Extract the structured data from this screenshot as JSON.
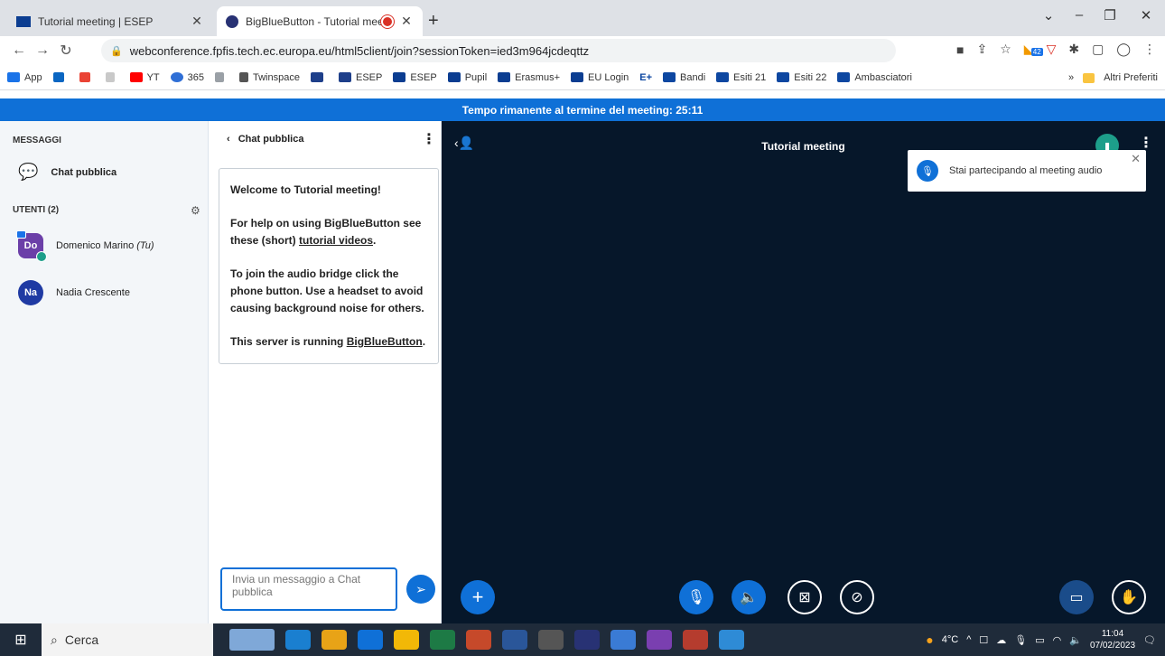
{
  "browser": {
    "tabs": [
      {
        "title": "Tutorial meeting | ESEP"
      },
      {
        "title": "BigBlueButton - Tutorial mee"
      }
    ],
    "url": "webconference.fpfis.tech.ec.europa.eu/html5client/join?sessionToken=ied3m964jcdeqttz",
    "extension_badge": "42"
  },
  "bookmarks": [
    "App",
    "YT",
    "365",
    "Twinspace",
    "ESEP",
    "ESEP",
    "Pupil",
    "Erasmus+",
    "EU Login",
    "E+",
    "Bandi",
    "Esiti 21",
    "Esiti 22",
    "Ambasciatori"
  ],
  "bookmarks_more": "»",
  "bookmarks_other": "Altri Preferiti",
  "banner": "Tempo rimanente al termine del meeting: 25:11",
  "sidebar": {
    "messages_title": "MESSAGGI",
    "public_chat": "Chat pubblica",
    "users_title": "UTENTI (2)",
    "users": [
      {
        "initials": "Do",
        "name": "Domenico Marino",
        "suffix": "(Tu)",
        "color": "#6b3fa8"
      },
      {
        "initials": "Na",
        "name": "Nadia Crescente",
        "color": "#1f3aa3"
      }
    ]
  },
  "chat": {
    "header": "Chat pubblica",
    "welcome_title": "Welcome to Tutorial meeting!",
    "help_prefix": "For help on using BigBlueButton see these (short) ",
    "help_link": "tutorial videos",
    "help_suffix": ".",
    "audio_text": "To join the audio bridge click the phone button. Use a headset to avoid causing background noise for others.",
    "server_prefix": "This server is running ",
    "server_link": "BigBlueButton",
    "server_suffix": ".",
    "input_placeholder": "Invia un messaggio a Chat pubblica"
  },
  "main": {
    "meeting_title": "Tutorial meeting",
    "toast": "Stai partecipando al meeting audio"
  },
  "taskbar": {
    "search": "Cerca",
    "temperature": "4°C",
    "time": "11:04",
    "date": "07/02/2023"
  }
}
